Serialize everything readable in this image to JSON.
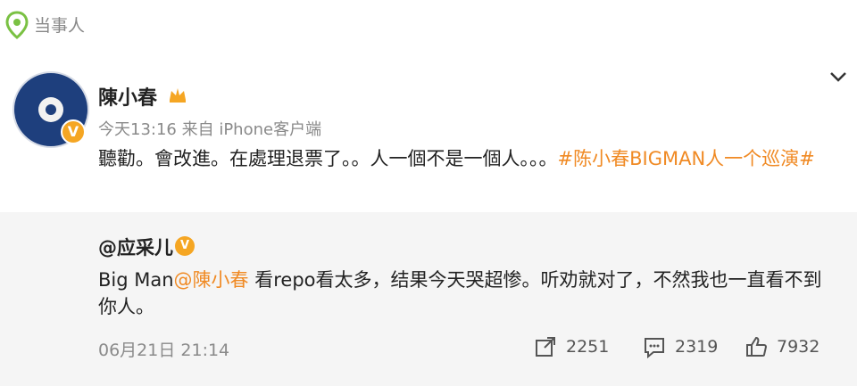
{
  "header": {
    "source_label": "当事人",
    "location_icon": "location-pin-icon"
  },
  "post": {
    "author_name": "陳小春",
    "crown_icon": "crown-icon",
    "verified_badge": "V",
    "meta": "今天13:16 来自 iPhone客户端",
    "text_main": "聽勸。會改進。在處理退票了。。人一個不是一個人。。。",
    "topic": "#陈小春BIGMAN人一个巡演#",
    "colors": {
      "accent": "#f08a24",
      "verified": "#f5a623"
    }
  },
  "repost": {
    "author_name": "@应采儿",
    "verified_badge": "V",
    "text_before": "Big Man",
    "mention": "@陳小春",
    "text_after": " 看repo看太多，结果今天哭超惨。听劝就对了，不然我也一直看不到你人。",
    "time": "06月21日 21:14",
    "actions": {
      "share_count": "2251",
      "comment_count": "2319",
      "like_count": "7932"
    }
  }
}
